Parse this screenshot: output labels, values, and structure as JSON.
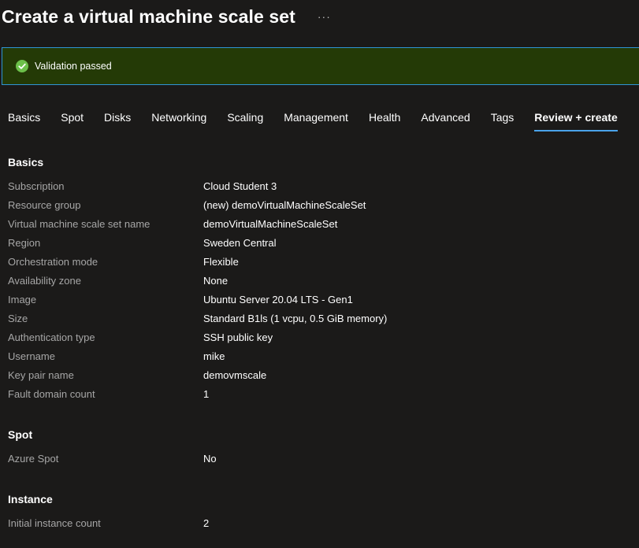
{
  "header": {
    "title": "Create a virtual machine scale set",
    "more_label": "···"
  },
  "banner": {
    "text": "Validation passed",
    "icon": "check-circle-icon",
    "background": "#243a06",
    "border": "#2f95d6",
    "icon_color": "#6cc04a"
  },
  "tabs": [
    {
      "label": "Basics"
    },
    {
      "label": "Spot"
    },
    {
      "label": "Disks"
    },
    {
      "label": "Networking"
    },
    {
      "label": "Scaling"
    },
    {
      "label": "Management"
    },
    {
      "label": "Health"
    },
    {
      "label": "Advanced"
    },
    {
      "label": "Tags"
    },
    {
      "label": "Review + create",
      "active": true
    }
  ],
  "sections": {
    "basics": {
      "title": "Basics",
      "rows": [
        {
          "label": "Subscription",
          "value": "Cloud Student 3"
        },
        {
          "label": "Resource group",
          "value": "(new) demoVirtualMachineScaleSet"
        },
        {
          "label": "Virtual machine scale set name",
          "value": "demoVirtualMachineScaleSet"
        },
        {
          "label": "Region",
          "value": "Sweden Central"
        },
        {
          "label": "Orchestration mode",
          "value": "Flexible"
        },
        {
          "label": "Availability zone",
          "value": "None"
        },
        {
          "label": "Image",
          "value": "Ubuntu Server 20.04 LTS - Gen1"
        },
        {
          "label": "Size",
          "value": "Standard B1ls (1 vcpu, 0.5 GiB memory)"
        },
        {
          "label": "Authentication type",
          "value": "SSH public key"
        },
        {
          "label": "Username",
          "value": "mike"
        },
        {
          "label": "Key pair name",
          "value": "demovmscale"
        },
        {
          "label": "Fault domain count",
          "value": "1"
        }
      ]
    },
    "spot": {
      "title": "Spot",
      "rows": [
        {
          "label": "Azure Spot",
          "value": "No"
        }
      ]
    },
    "instance": {
      "title": "Instance",
      "rows": [
        {
          "label": "Initial instance count",
          "value": "2"
        }
      ]
    }
  },
  "colors": {
    "background": "#1b1a19",
    "accent": "#4aa3ea",
    "label": "#a6a6a6"
  }
}
